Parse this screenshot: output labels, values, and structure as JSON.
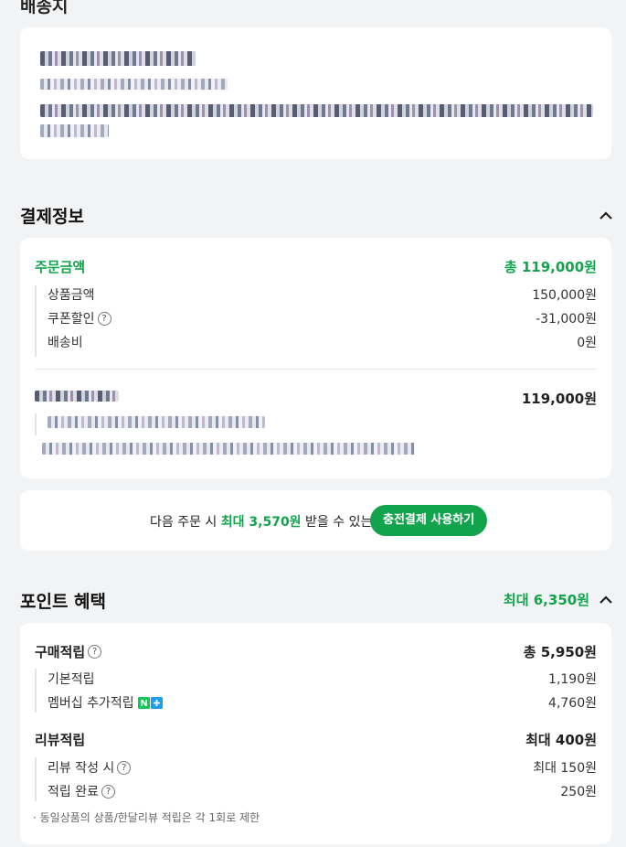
{
  "delivery": {
    "title_partial": "배송지"
  },
  "payment": {
    "title": "결제정보",
    "order_amount_label": "주문금액",
    "order_amount_value": "총 119,000원",
    "items": [
      {
        "label": "상품금액",
        "value": "150,000원",
        "help": false
      },
      {
        "label": "쿠폰할인",
        "value": "-31,000원",
        "help": true
      },
      {
        "label": "배송비",
        "value": "0원",
        "help": false
      }
    ],
    "method_amount": "119,000원"
  },
  "promo": {
    "text_before": "다음 주문 시",
    "text_highlight": "최대 3,570원",
    "text_after": "받을 수 있는",
    "button_label": "충전결제 사용하기"
  },
  "points": {
    "title": "포인트 혜택",
    "max_label": "최대 6,350원",
    "purchase_label": "구매적립",
    "purchase_value": "총 5,950원",
    "purchase_items": [
      {
        "label": "기본적립",
        "value": "1,190원"
      },
      {
        "label": "멤버십 추가적립",
        "value": "4,760원"
      }
    ],
    "review_label": "리뷰적립",
    "review_value": "최대 400원",
    "review_items": [
      {
        "label": "리뷰 작성 시",
        "value": "최대 150원"
      },
      {
        "label": "적립 완료",
        "value": "250원"
      }
    ],
    "note": "· 동일상품의 상품/한달리뷰 적립은 각 1회로 제한"
  },
  "colors": {
    "accent": "#12a44c",
    "background": "#f2f3f5"
  }
}
